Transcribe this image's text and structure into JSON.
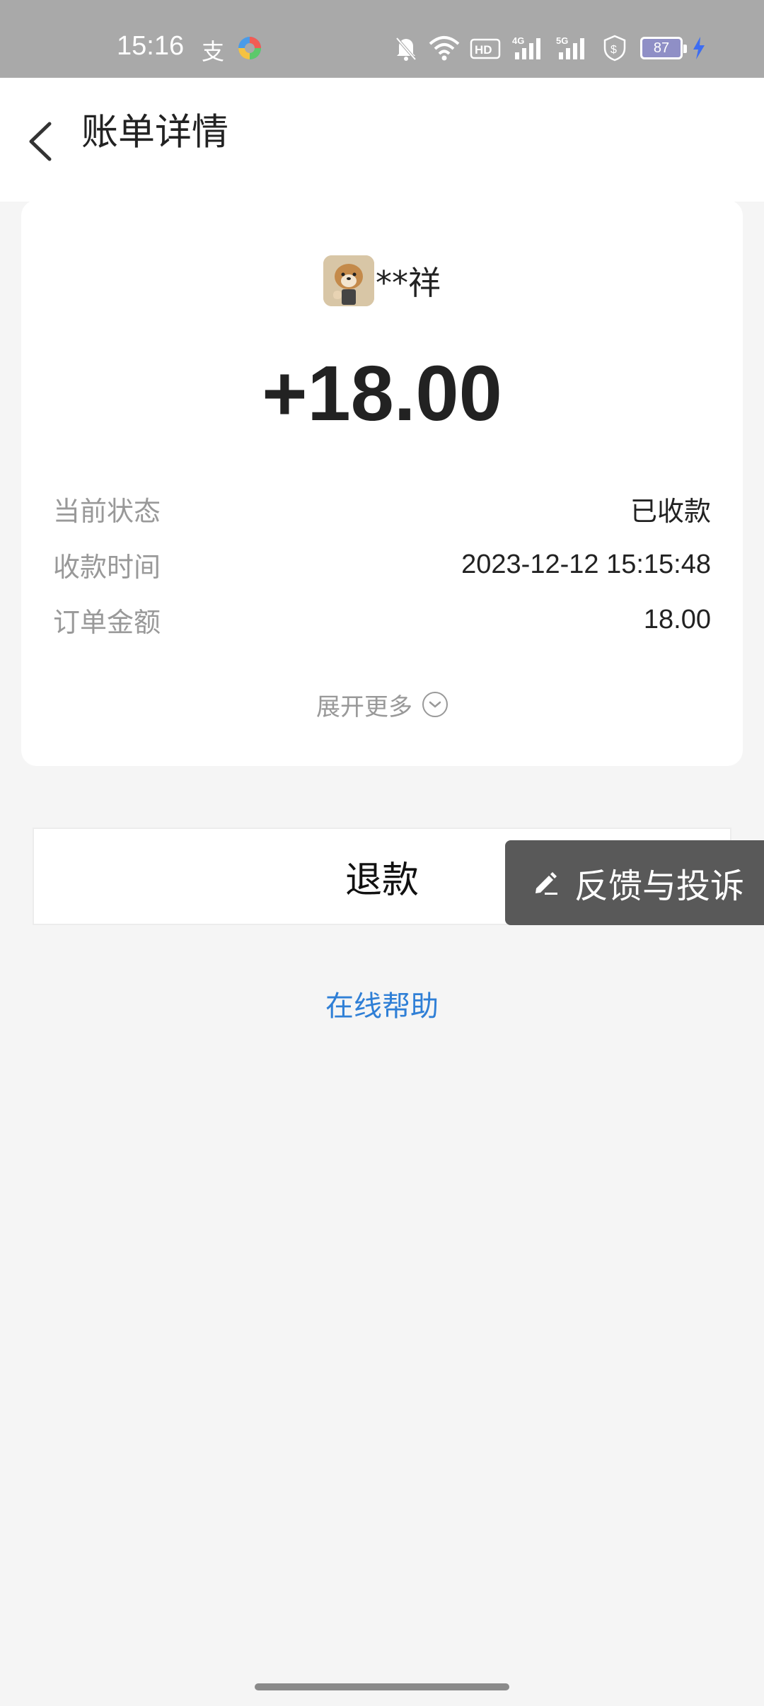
{
  "status_bar": {
    "time": "15:16",
    "left_glyph": "支",
    "battery_level": "87",
    "icons": [
      "silent-bell-icon",
      "wifi-icon",
      "hd-icon",
      "signal-4g-icon",
      "signal-5g-icon",
      "shield-dollar-icon",
      "battery-icon",
      "charging-bolt-icon"
    ]
  },
  "header": {
    "title": "账单详情"
  },
  "card": {
    "payer_name": "**祥",
    "amount": "+18.00",
    "rows": [
      {
        "label": "当前状态",
        "value": "已收款"
      },
      {
        "label": "收款时间",
        "value": "2023-12-12 15:15:48"
      },
      {
        "label": "订单金额",
        "value": "18.00"
      }
    ],
    "expand_label": "展开更多"
  },
  "actions": {
    "refund_label": "退款",
    "feedback_label": "反馈与投诉",
    "help_label": "在线帮助"
  },
  "colors": {
    "status_bar_bg": "#a9a9a9",
    "link_blue": "#2f7fd6",
    "feedback_bg": "#595959"
  }
}
